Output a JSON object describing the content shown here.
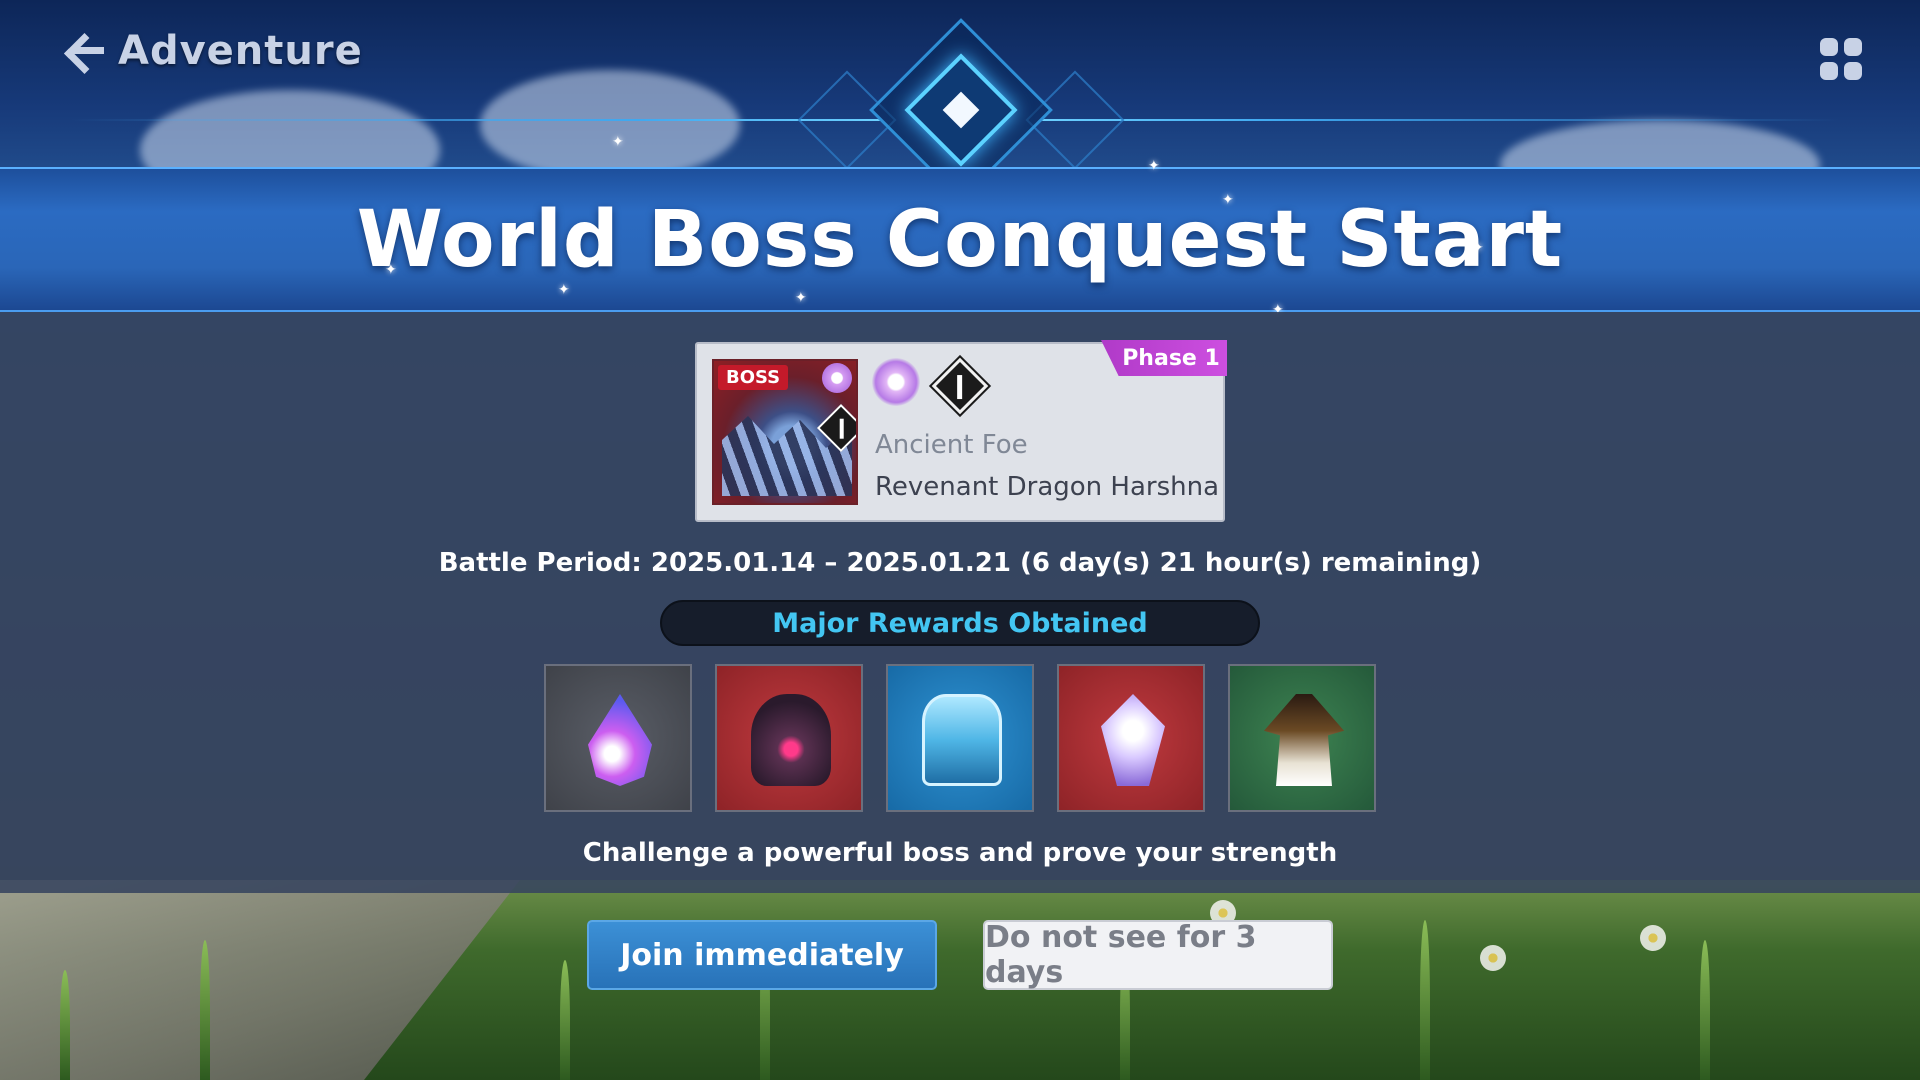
{
  "header": {
    "back_label": "Adventure"
  },
  "banner": {
    "title": "World Boss Conquest Start"
  },
  "boss": {
    "tag": "BOSS",
    "phase": "Phase 1",
    "subtitle": "Ancient Foe",
    "name": "Revenant Dragon Harshna"
  },
  "battle_period": "Battle Period: 2025.01.14 – 2025.01.21 (6 day(s) 21 hour(s) remaining)",
  "rewards": {
    "title": "Major Rewards Obtained",
    "items": [
      {
        "icon": "crystal-drop-icon",
        "frame_color": "#4a4d55"
      },
      {
        "icon": "dark-helmet-icon",
        "frame_color": "#a82c31"
      },
      {
        "icon": "ice-chest-icon",
        "frame_color": "#1f7fc0"
      },
      {
        "icon": "gem-emblem-icon",
        "frame_color": "#a82c31"
      },
      {
        "icon": "robe-costume-icon",
        "frame_color": "#2f6e46"
      }
    ]
  },
  "description": "Challenge a powerful boss and prove your strength",
  "buttons": {
    "join": "Join immediately",
    "hide": "Do not see for 3 days"
  },
  "colors": {
    "banner": "#2a66b8",
    "phase_tag": "#c046d8",
    "rewards_title": "#43c6f2",
    "join_button": "#3280c8"
  }
}
